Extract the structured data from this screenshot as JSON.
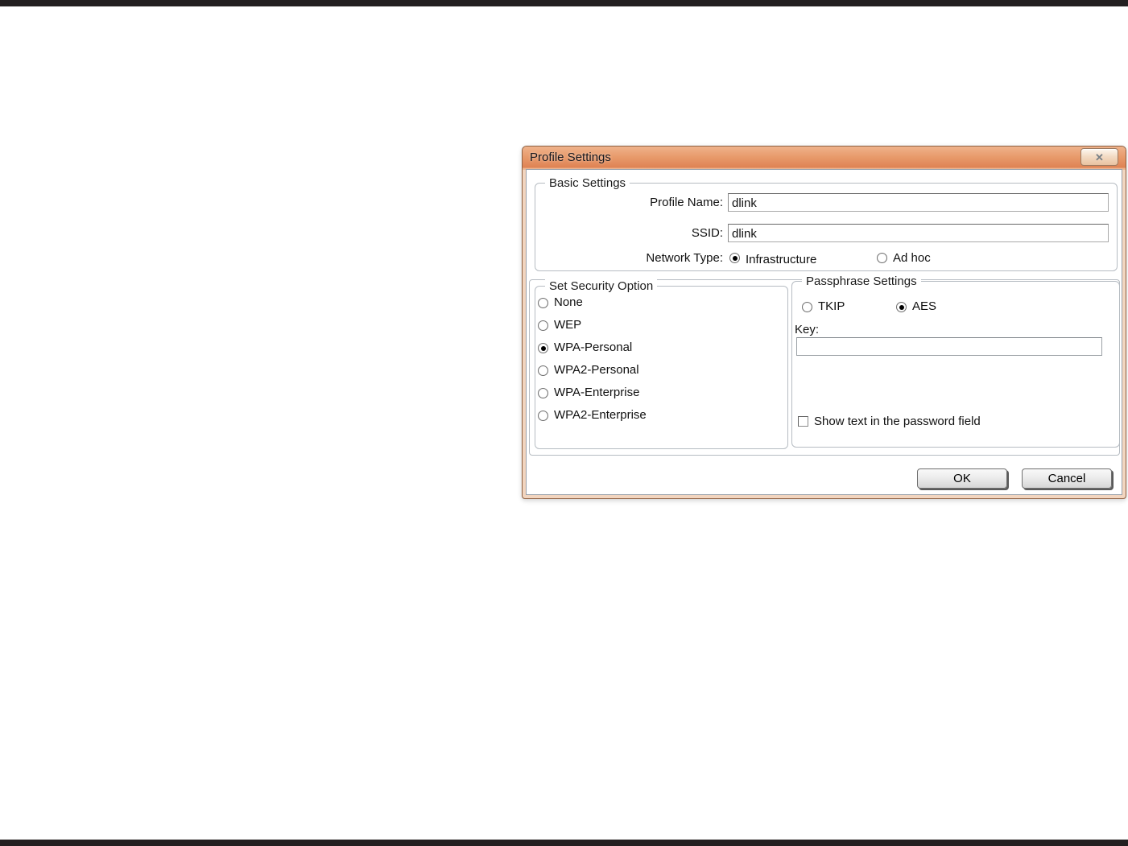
{
  "page": {
    "rule_color": "#231f20"
  },
  "dialog": {
    "title": "Profile Settings",
    "close_glyph": "✕",
    "basic": {
      "legend": "Basic Settings",
      "profile_name_label": "Profile Name:",
      "profile_name_value": "dlink",
      "ssid_label": "SSID:",
      "ssid_value": "dlink",
      "network_type_label": "Network Type:",
      "network_options": [
        {
          "label": "Infrastructure",
          "selected": true
        },
        {
          "label": "Ad hoc",
          "selected": false
        }
      ]
    },
    "security": {
      "legend": "Set Security Option",
      "options": [
        {
          "label": "None",
          "selected": false
        },
        {
          "label": "WEP",
          "selected": false
        },
        {
          "label": "WPA-Personal",
          "selected": true
        },
        {
          "label": "WPA2-Personal",
          "selected": false
        },
        {
          "label": "WPA-Enterprise",
          "selected": false
        },
        {
          "label": "WPA2-Enterprise",
          "selected": false
        }
      ]
    },
    "passphrase": {
      "legend": "Passphrase Settings",
      "cipher_options": [
        {
          "label": "TKIP",
          "selected": false
        },
        {
          "label": "AES",
          "selected": true
        }
      ],
      "key_label": "Key:",
      "key_value": "",
      "show_text_label": "Show text in the password field",
      "show_text_checked": false
    },
    "buttons": {
      "ok": "OK",
      "cancel": "Cancel"
    }
  }
}
